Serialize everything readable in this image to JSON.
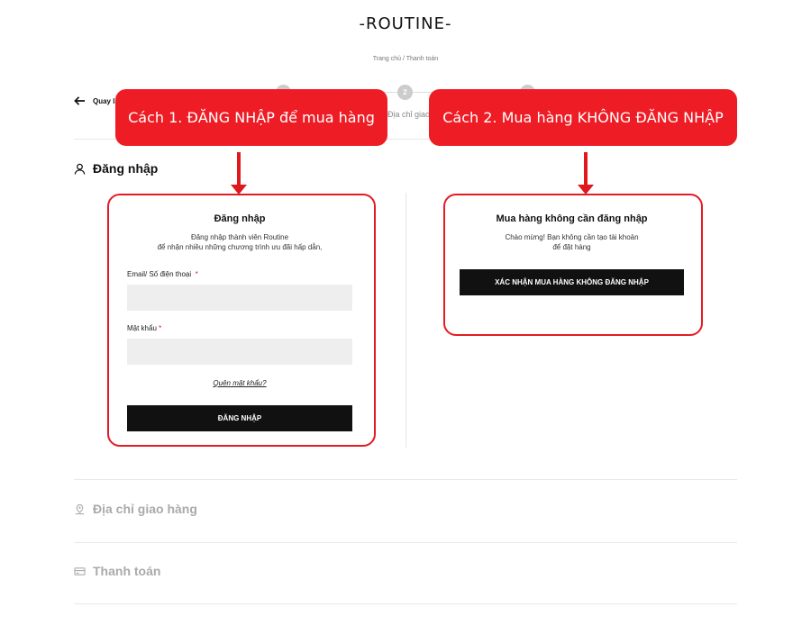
{
  "header": {
    "logo": "-ROUTINE-",
    "breadcrumb": "Trang chủ / Thanh toán"
  },
  "nav": {
    "back_label": "Quay lại",
    "steps": [
      {
        "number": "1",
        "label": ""
      },
      {
        "number": "2",
        "label": "Địa chỉ giao hàng"
      },
      {
        "number": "3",
        "label": ""
      }
    ]
  },
  "callouts": {
    "left": "Cách 1. ĐĂNG NHẬP để mua hàng",
    "right": "Cách 2. Mua hàng KHÔNG ĐĂNG NHẬP"
  },
  "sections": {
    "login": "Đăng nhập",
    "address": "Địa chỉ giao hàng",
    "payment": "Thanh toán"
  },
  "login_card": {
    "title": "Đăng nhập",
    "subtitle_line1": "Đăng nhập thành viên Routine",
    "subtitle_line2": "để nhận nhiều những chương trình ưu đãi hấp dẫn,",
    "email_label": "Email/ Số điện thoại",
    "email_value": "",
    "password_label": "Mật khẩu",
    "password_value": "",
    "required_mark": "*",
    "forgot_link": "Quên mật khẩu?",
    "submit_label": "ĐĂNG NHẬP"
  },
  "guest_card": {
    "title": "Mua hàng không cần đăng nhập",
    "subtitle_line1": "Chào mừng! Bạn không cần tạo tài khoản",
    "subtitle_line2": "để đặt hàng",
    "confirm_label": "XÁC NHẬN MUA HÀNG KHÔNG ĐĂNG NHẬP"
  },
  "colors": {
    "accent_red": "#ee1c25",
    "button_black": "#111111",
    "field_gray": "#eeeeee"
  }
}
